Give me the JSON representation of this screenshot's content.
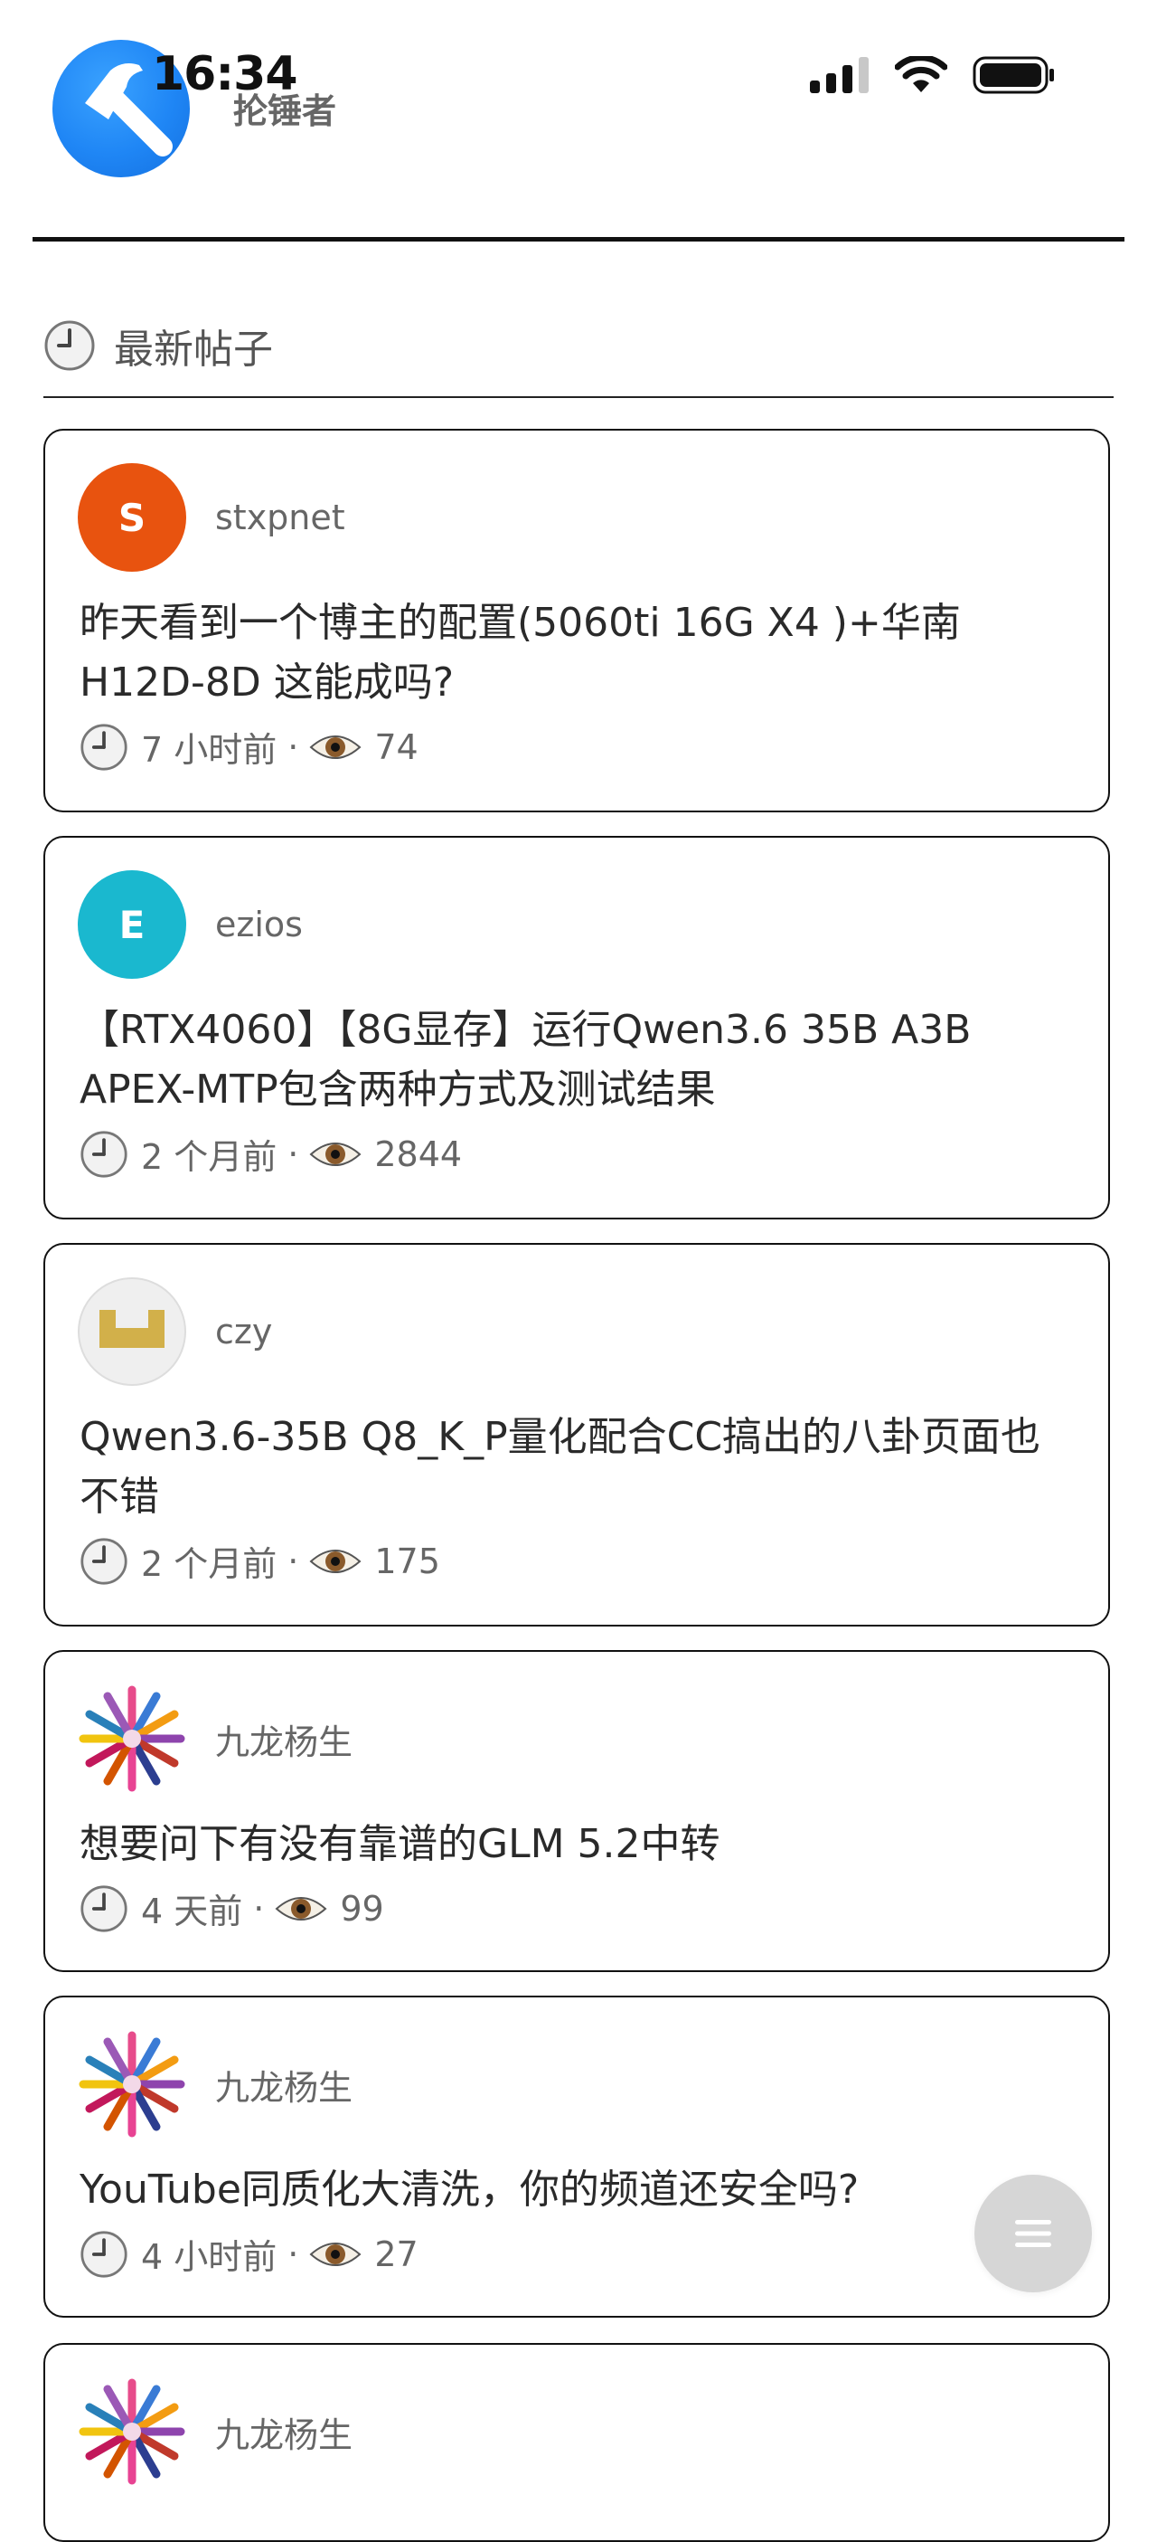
{
  "status_bar": {
    "time": "16:34"
  },
  "header": {
    "site_name": "抡锤者",
    "logo_icon": "hammer-icon"
  },
  "section": {
    "title": "最新帖子",
    "icon": "clock-icon"
  },
  "posts": [
    {
      "author": "stxpnet",
      "avatar_letter": "S",
      "avatar_color": "#e8530f",
      "title": "昨天看到一个博主的配置(5060ti 16G X4 )+华南H12D-8D 这能成吗?",
      "time": "7 小时前",
      "views": "74"
    },
    {
      "author": "ezios",
      "avatar_letter": "E",
      "avatar_color": "#1ab8cf",
      "title": "【RTX4060】【8G显存】运行Qwen3.6 35B A3B APEX-MTP包含两种方式及测试结果",
      "time": "2 个月前",
      "views": "2844"
    },
    {
      "author": "czy",
      "avatar_letter": "",
      "title": "Qwen3.6-35B Q8_K_P量化配合CC搞出的八卦页面也不错",
      "time": "2 个月前",
      "views": "175"
    },
    {
      "author": "九龙杨生",
      "avatar_letter": "",
      "title": "想要问下有没有靠谱的GLM 5.2中转",
      "time": "4 天前",
      "views": "99"
    },
    {
      "author": "九龙杨生",
      "avatar_letter": "",
      "title": "YouTube同质化大清洗，你的频道还安全吗?",
      "time": "4 小时前",
      "views": "27"
    },
    {
      "author": "九龙杨生",
      "avatar_letter": ""
    }
  ],
  "meta_separator": "·",
  "fab": {
    "icon": "menu-icon"
  }
}
